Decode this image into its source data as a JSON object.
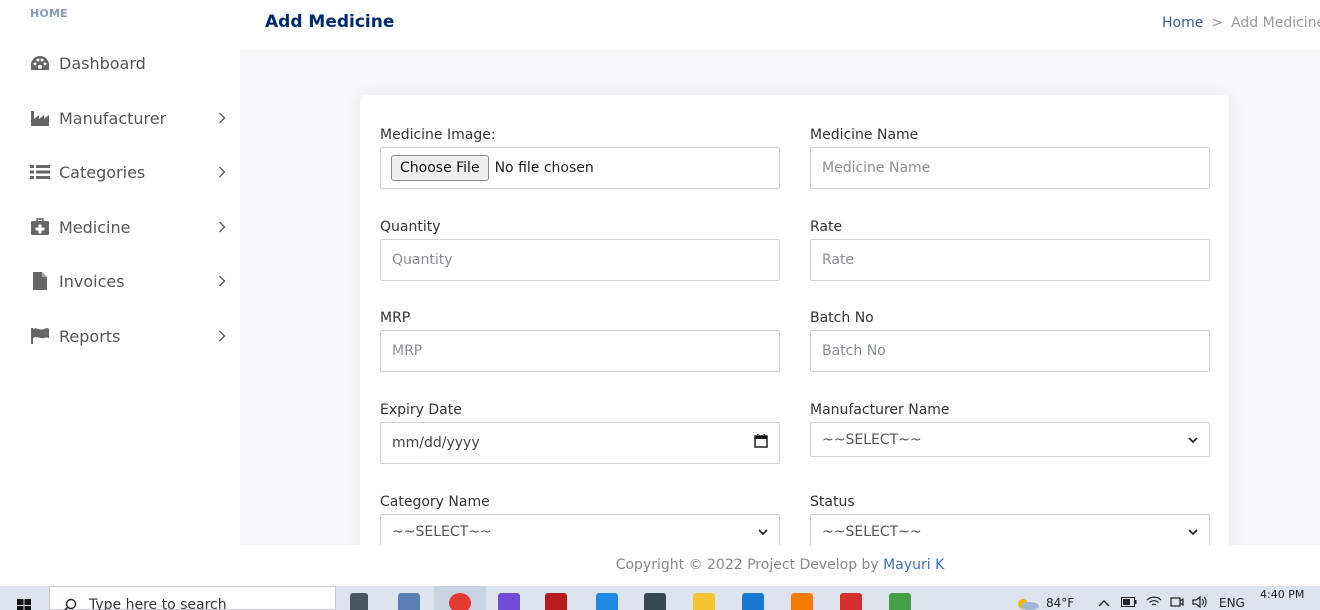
{
  "sidebar": {
    "heading": "HOME",
    "items": [
      {
        "label": "Dashboard",
        "icon": "dashboard-icon",
        "has_submenu": false
      },
      {
        "label": "Manufacturer",
        "icon": "factory-icon",
        "has_submenu": true
      },
      {
        "label": "Categories",
        "icon": "list-icon",
        "has_submenu": true
      },
      {
        "label": "Medicine",
        "icon": "medical-kit-icon",
        "has_submenu": true
      },
      {
        "label": "Invoices",
        "icon": "file-icon",
        "has_submenu": true
      },
      {
        "label": "Reports",
        "icon": "flag-icon",
        "has_submenu": true
      }
    ]
  },
  "header": {
    "title": "Add Medicine",
    "breadcrumb": {
      "home": "Home",
      "separator": ">",
      "current": "Add Medicine"
    }
  },
  "form": {
    "medicine_image": {
      "label": "Medicine Image:",
      "button": "Choose File",
      "status": "No file chosen"
    },
    "medicine_name": {
      "label": "Medicine Name",
      "placeholder": "Medicine Name"
    },
    "quantity": {
      "label": "Quantity",
      "placeholder": "Quantity"
    },
    "rate": {
      "label": "Rate",
      "placeholder": "Rate"
    },
    "mrp": {
      "label": "MRP",
      "placeholder": "MRP"
    },
    "batch_no": {
      "label": "Batch No",
      "placeholder": "Batch No"
    },
    "expiry_date": {
      "label": "Expiry Date",
      "placeholder": "mm/dd/yyyy"
    },
    "manufacturer_name": {
      "label": "Manufacturer Name",
      "selected": "~~SELECT~~"
    },
    "category_name": {
      "label": "Category Name",
      "selected": "~~SELECT~~"
    },
    "status": {
      "label": "Status",
      "selected": "~~SELECT~~"
    }
  },
  "footer": {
    "copyright": "Copyright © 2022 Project Develop by ",
    "author": "Mayuri K"
  },
  "taskbar": {
    "search_placeholder": "Type here to search",
    "weather": "84°F",
    "language": "ENG",
    "time": "4:40 PM"
  },
  "colors": {
    "title": "#012970",
    "link": "#3a6fc4",
    "sidebar_text": "#555555",
    "background": "#f6f7f8"
  }
}
